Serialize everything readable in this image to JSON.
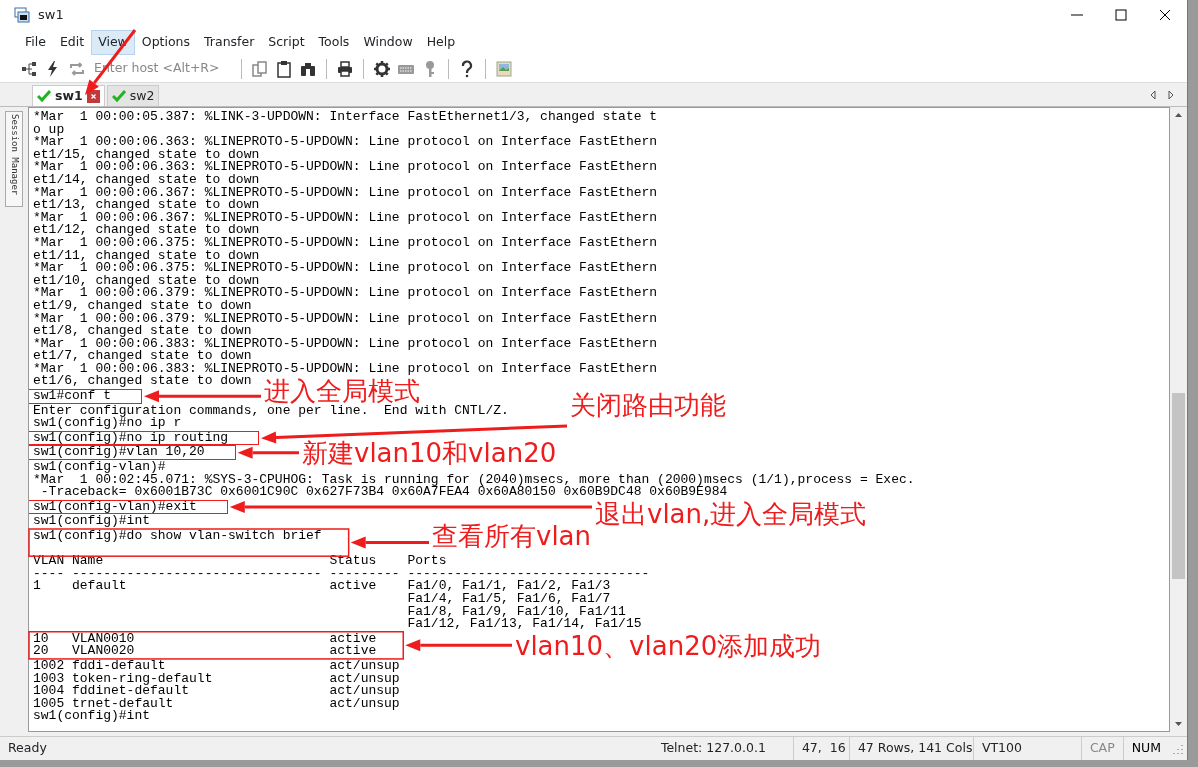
{
  "window": {
    "title": "sw1"
  },
  "menu": [
    {
      "label": "File",
      "selected": false
    },
    {
      "label": "Edit",
      "selected": false
    },
    {
      "label": "View",
      "selected": true
    },
    {
      "label": "Options",
      "selected": false
    },
    {
      "label": "Transfer",
      "selected": false
    },
    {
      "label": "Script",
      "selected": false
    },
    {
      "label": "Tools",
      "selected": false
    },
    {
      "label": "Window",
      "selected": false
    },
    {
      "label": "Help",
      "selected": false
    }
  ],
  "toolbar": {
    "host_field": {
      "placeholder": "Enter host <Alt+R>"
    }
  },
  "tabs": [
    {
      "label": "sw1",
      "selected": true
    },
    {
      "label": "sw2",
      "selected": false
    }
  ],
  "side_panel": {
    "label": "Session Manager"
  },
  "terminal": {
    "lines": [
      {
        "text": "*Mar  1 00:00:05.387: %LINK-3-UPDOWN: Interface FastEthernet1/3, changed state t"
      },
      {
        "text": "o up"
      },
      {
        "text": "*Mar  1 00:00:06.363: %LINEPROTO-5-UPDOWN: Line protocol on Interface FastEthern"
      },
      {
        "text": "et1/15, changed state to down"
      },
      {
        "text": "*Mar  1 00:00:06.363: %LINEPROTO-5-UPDOWN: Line protocol on Interface FastEthern"
      },
      {
        "text": "et1/14, changed state to down"
      },
      {
        "text": "*Mar  1 00:00:06.367: %LINEPROTO-5-UPDOWN: Line protocol on Interface FastEthern"
      },
      {
        "text": "et1/13, changed state to down"
      },
      {
        "text": "*Mar  1 00:00:06.367: %LINEPROTO-5-UPDOWN: Line protocol on Interface FastEthern"
      },
      {
        "text": "et1/12, changed state to down"
      },
      {
        "text": "*Mar  1 00:00:06.375: %LINEPROTO-5-UPDOWN: Line protocol on Interface FastEthern"
      },
      {
        "text": "et1/11, changed state to down"
      },
      {
        "text": "*Mar  1 00:00:06.375: %LINEPROTO-5-UPDOWN: Line protocol on Interface FastEthern"
      },
      {
        "text": "et1/10, changed state to down"
      },
      {
        "text": "*Mar  1 00:00:06.379: %LINEPROTO-5-UPDOWN: Line protocol on Interface FastEthern"
      },
      {
        "text": "et1/9, changed state to down"
      },
      {
        "text": "*Mar  1 00:00:06.379: %LINEPROTO-5-UPDOWN: Line protocol on Interface FastEthern"
      },
      {
        "text": "et1/8, changed state to down"
      },
      {
        "text": "*Mar  1 00:00:06.383: %LINEPROTO-5-UPDOWN: Line protocol on Interface FastEthern"
      },
      {
        "text": "et1/7, changed state to down"
      },
      {
        "text": "*Mar  1 00:00:06.383: %LINEPROTO-5-UPDOWN: Line protocol on Interface FastEthern"
      },
      {
        "text": "et1/6, changed state to down"
      },
      {
        "text": "sw1#conf t"
      },
      {
        "text": "Enter configuration commands, one per line.  End with CNTL/Z."
      },
      {
        "text": "sw1(config)#no ip r"
      },
      {
        "text": "sw1(config)#no ip routing"
      },
      {
        "text": "sw1(config)#vlan 10,20"
      },
      {
        "text": "sw1(config-vlan)#"
      },
      {
        "text": "*Mar  1 00:02:45.071: %SYS-3-CPUHOG: Task is running for (2040)msecs, more than (2000)msecs (1/1),process = Exec."
      },
      {
        "text": " -Traceback= 0x6001B73C 0x6001C90C 0x627F73B4 0x60A7FEA4 0x60A80150 0x60B9DC48 0x60B9E984"
      },
      {
        "text": "sw1(config-vlan)#exit"
      },
      {
        "text": "sw1(config)#int"
      },
      {
        "text": "sw1(config)#do show vlan-switch brief"
      },
      {
        "text": "VLAN Name                             Status    Ports",
        "blank_before": true
      },
      {
        "text": "---- -------------------------------- --------- -------------------------------"
      },
      {
        "text": "1    default                          active    Fa1/0, Fa1/1, Fa1/2, Fa1/3"
      },
      {
        "text": "                                                Fa1/4, Fa1/5, Fa1/6, Fa1/7"
      },
      {
        "text": "                                                Fa1/8, Fa1/9, Fa1/10, Fa1/11"
      },
      {
        "text": "                                                Fa1/12, Fa1/13, Fa1/14, Fa1/15"
      },
      {
        "text": "10   VLAN0010                         active"
      },
      {
        "text": "20   VLAN0020                         active"
      },
      {
        "text": "1002 fddi-default                     act/unsup"
      },
      {
        "text": "1003 token-ring-default               act/unsup"
      },
      {
        "text": "1004 fddinet-default                  act/unsup"
      },
      {
        "text": "1005 trnet-default                    act/unsup"
      },
      {
        "text": "sw1(config)#int"
      }
    ]
  },
  "annotations": [
    "进入全局模式",
    "关闭路由功能",
    "新建vlan10和vlan20",
    "退出vlan,进入全局模式",
    "查看所有vlan",
    "vlan10、vlan20添加成功"
  ],
  "status_bar": {
    "message": "Ready",
    "connection": "Telnet: 127.0.0.1",
    "cursor": "47,  16",
    "size": "47 Rows, 141 Cols",
    "emulation": "VT100",
    "indicators": [
      {
        "label": "CAP",
        "on": false
      },
      {
        "label": "NUM",
        "on": true
      }
    ]
  }
}
